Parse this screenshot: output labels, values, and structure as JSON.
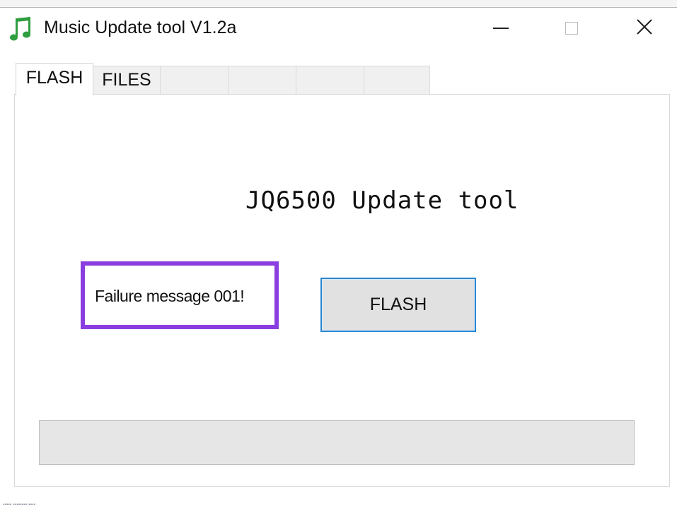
{
  "window": {
    "title": "Music Update tool V1.2a",
    "app_icon": "music-note-icon",
    "controls": {
      "minimize_icon": "minimize-icon",
      "maximize_icon": "maximize-icon",
      "close_icon": "close-icon",
      "close_glyph": "✕"
    }
  },
  "tabs": [
    {
      "label": "FLASH",
      "active": true
    },
    {
      "label": "FILES",
      "active": false
    },
    {
      "label": "",
      "active": false
    },
    {
      "label": "",
      "active": false
    },
    {
      "label": "",
      "active": false
    },
    {
      "label": "",
      "active": false
    }
  ],
  "main": {
    "heading": "JQ6500 Update tool",
    "status_message": "Failure message 001!",
    "flash_button_label": "FLASH",
    "progress_fraction": 0
  },
  "colors": {
    "highlight_border": "#8a3ee0",
    "button_focus_border": "#2b87d1",
    "icon_green": "#2e9e3f"
  }
}
